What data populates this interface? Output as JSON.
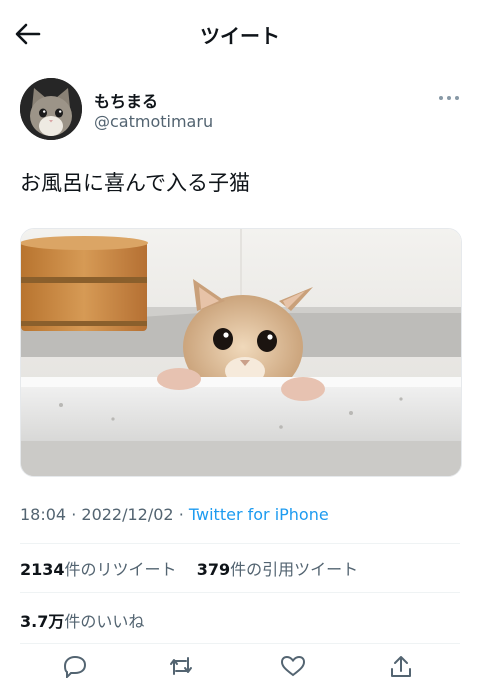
{
  "header": {
    "title": "ツイート"
  },
  "tweet": {
    "display_name": "もちまる",
    "handle": "@catmotimaru",
    "text": "お風呂に喜んで入る子猫",
    "time": "18:04",
    "date": "2022/12/02",
    "separator": "·",
    "source": "Twitter for iPhone"
  },
  "stats": {
    "retweets": {
      "count": "2134",
      "label": "件のリツイート"
    },
    "quotes": {
      "count": "379",
      "label": "件の引用ツイート"
    },
    "likes": {
      "count": "3.7万",
      "label": "件のいいね"
    }
  },
  "colors": {
    "text": "#0f1419",
    "secondary": "#536471",
    "link": "#1d9bf0",
    "divider": "#eff3f4"
  },
  "icons": {
    "back": "arrow-left-icon",
    "more": "more-horizontal-icon",
    "reply": "reply-icon",
    "retweet": "retweet-icon",
    "like": "heart-icon",
    "share": "share-icon"
  }
}
